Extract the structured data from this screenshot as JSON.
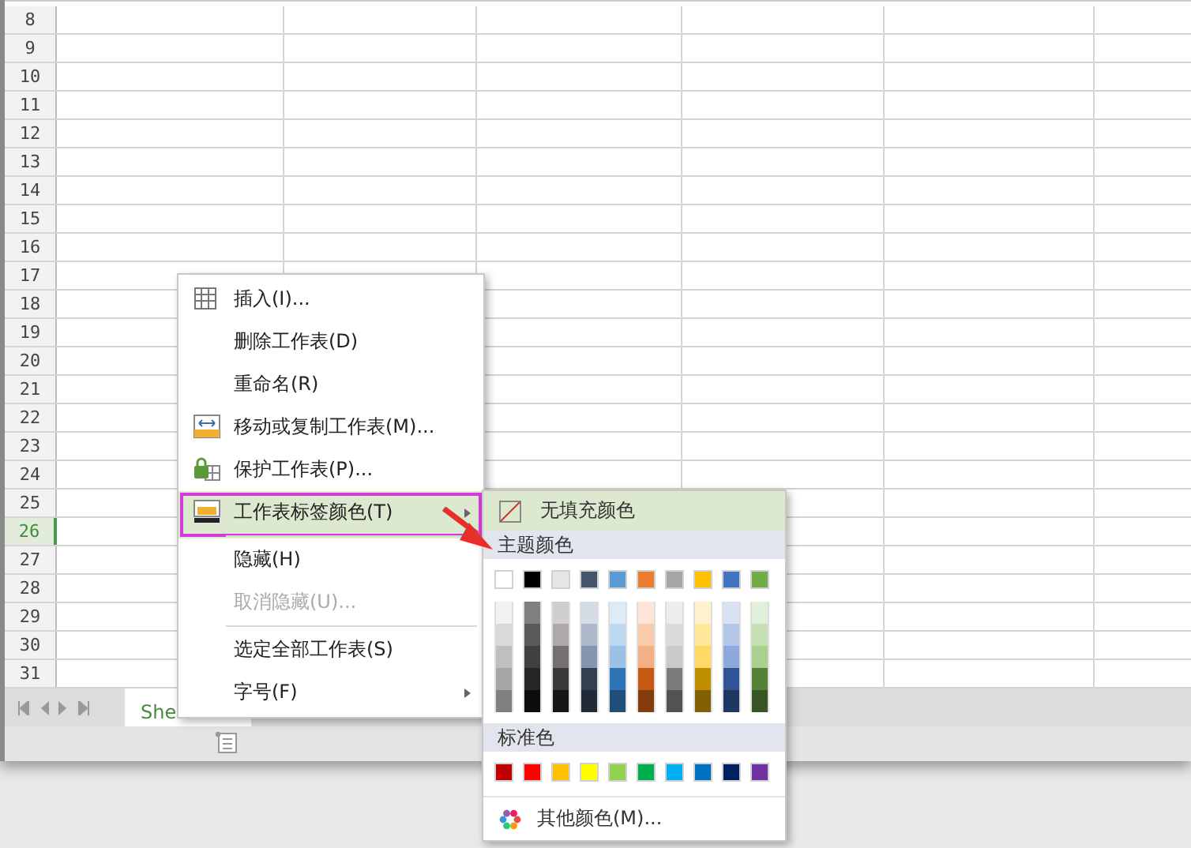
{
  "rows": [
    {
      "label": "8",
      "selected": false
    },
    {
      "label": "9",
      "selected": false
    },
    {
      "label": "10",
      "selected": false
    },
    {
      "label": "11",
      "selected": false
    },
    {
      "label": "12",
      "selected": false
    },
    {
      "label": "13",
      "selected": false
    },
    {
      "label": "14",
      "selected": false
    },
    {
      "label": "15",
      "selected": false
    },
    {
      "label": "16",
      "selected": false
    },
    {
      "label": "17",
      "selected": false
    },
    {
      "label": "18",
      "selected": false
    },
    {
      "label": "19",
      "selected": false
    },
    {
      "label": "20",
      "selected": false
    },
    {
      "label": "21",
      "selected": false
    },
    {
      "label": "22",
      "selected": false
    },
    {
      "label": "23",
      "selected": false
    },
    {
      "label": "24",
      "selected": false
    },
    {
      "label": "25",
      "selected": false
    },
    {
      "label": "26",
      "selected": true
    },
    {
      "label": "27",
      "selected": false
    },
    {
      "label": "28",
      "selected": false
    },
    {
      "label": "29",
      "selected": false
    },
    {
      "label": "30",
      "selected": false
    },
    {
      "label": "31",
      "selected": false
    }
  ],
  "sheet_tabs": [
    {
      "label": "She",
      "selected": true
    }
  ],
  "context_menu": {
    "items": [
      {
        "kind": "grid",
        "label": "插入(I)...",
        "disabled": false,
        "selected": false,
        "submenu": false,
        "separator_after": false
      },
      {
        "kind": "plain",
        "label": "删除工作表(D)",
        "disabled": false,
        "selected": false,
        "submenu": false,
        "separator_after": false
      },
      {
        "kind": "plain",
        "label": "重命名(R)",
        "disabled": false,
        "selected": false,
        "submenu": false,
        "separator_after": false
      },
      {
        "kind": "move",
        "label": "移动或复制工作表(M)...",
        "disabled": false,
        "selected": false,
        "submenu": false,
        "separator_after": false
      },
      {
        "kind": "lock",
        "label": "保护工作表(P)...",
        "disabled": false,
        "selected": false,
        "submenu": false,
        "separator_after": false
      },
      {
        "kind": "tabcolor",
        "label": "工作表标签颜色(T)",
        "disabled": false,
        "selected": true,
        "submenu": true,
        "separator_after": true
      },
      {
        "kind": "plain",
        "label": "隐藏(H)",
        "disabled": false,
        "selected": false,
        "submenu": false,
        "separator_after": false
      },
      {
        "kind": "plain",
        "label": "取消隐藏(U)...",
        "disabled": true,
        "selected": false,
        "submenu": false,
        "separator_after": true
      },
      {
        "kind": "plain",
        "label": "选定全部工作表(S)",
        "disabled": false,
        "selected": false,
        "submenu": false,
        "separator_after": false
      },
      {
        "kind": "plain",
        "label": "字号(F)",
        "disabled": false,
        "selected": false,
        "submenu": true,
        "separator_after": false
      }
    ]
  },
  "color_menu": {
    "no_fill": {
      "label": "无填充颜色",
      "selected": true
    },
    "theme_title": "主题颜色",
    "theme_colors": [
      {
        "color": "#ffffff"
      },
      {
        "color": "#000000"
      },
      {
        "color": "#e7e6e6"
      },
      {
        "color": "#44546a"
      },
      {
        "color": "#5b9bd5"
      },
      {
        "color": "#ed7d31"
      },
      {
        "color": "#a5a5a5"
      },
      {
        "color": "#ffc000"
      },
      {
        "color": "#4472c4"
      },
      {
        "color": "#70ad47"
      }
    ],
    "shade_rows": [
      {
        "swatches": [
          {
            "color": "#f2f2f2"
          },
          {
            "color": "#808080"
          },
          {
            "color": "#d0cece"
          },
          {
            "color": "#d6dce4"
          },
          {
            "color": "#ddebf7"
          },
          {
            "color": "#fce4d6"
          },
          {
            "color": "#ededed"
          },
          {
            "color": "#fff2cc"
          },
          {
            "color": "#d9e1f2"
          },
          {
            "color": "#e2efda"
          }
        ]
      },
      {
        "swatches": [
          {
            "color": "#d9d9d9"
          },
          {
            "color": "#595959"
          },
          {
            "color": "#aeaaaa"
          },
          {
            "color": "#adb9ca"
          },
          {
            "color": "#bdd7ee"
          },
          {
            "color": "#f8cbad"
          },
          {
            "color": "#dbdbdb"
          },
          {
            "color": "#ffe699"
          },
          {
            "color": "#b4c6e7"
          },
          {
            "color": "#c6e0b4"
          }
        ]
      },
      {
        "swatches": [
          {
            "color": "#bfbfbf"
          },
          {
            "color": "#404040"
          },
          {
            "color": "#757171"
          },
          {
            "color": "#8496b0"
          },
          {
            "color": "#9bc2e6"
          },
          {
            "color": "#f4b084"
          },
          {
            "color": "#c9c9c9"
          },
          {
            "color": "#ffd966"
          },
          {
            "color": "#8ea9db"
          },
          {
            "color": "#a9d08e"
          }
        ]
      },
      {
        "swatches": [
          {
            "color": "#a6a6a6"
          },
          {
            "color": "#262626"
          },
          {
            "color": "#3a3838"
          },
          {
            "color": "#333f4f"
          },
          {
            "color": "#2f75b5"
          },
          {
            "color": "#c65911"
          },
          {
            "color": "#7b7b7b"
          },
          {
            "color": "#bf8f00"
          },
          {
            "color": "#305496"
          },
          {
            "color": "#548235"
          }
        ]
      },
      {
        "swatches": [
          {
            "color": "#808080"
          },
          {
            "color": "#0d0d0d"
          },
          {
            "color": "#171616"
          },
          {
            "color": "#222a35"
          },
          {
            "color": "#1f4e78"
          },
          {
            "color": "#833c0c"
          },
          {
            "color": "#525252"
          },
          {
            "color": "#806000"
          },
          {
            "color": "#203764"
          },
          {
            "color": "#375623"
          }
        ]
      }
    ],
    "standard_title": "标准色",
    "standard_colors": [
      {
        "color": "#c00000"
      },
      {
        "color": "#ff0000"
      },
      {
        "color": "#ffc000"
      },
      {
        "color": "#ffff00"
      },
      {
        "color": "#92d050"
      },
      {
        "color": "#00b050"
      },
      {
        "color": "#00b0f0"
      },
      {
        "color": "#0070c0"
      },
      {
        "color": "#002060"
      },
      {
        "color": "#7030a0"
      }
    ],
    "more_colors": "其他颜色(M)..."
  }
}
